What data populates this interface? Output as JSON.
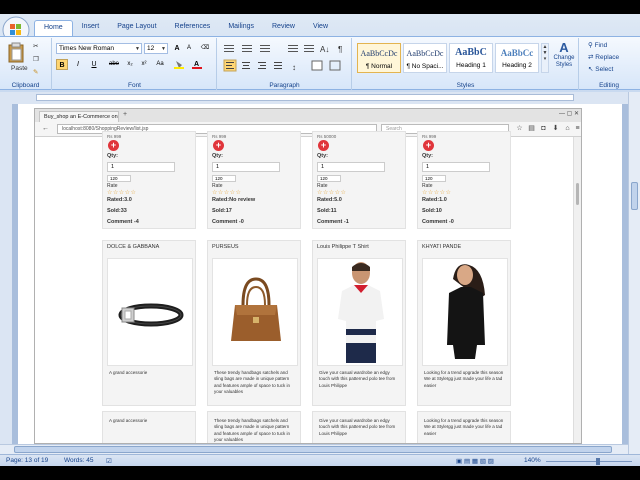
{
  "word": {
    "tabs": [
      "Home",
      "Insert",
      "Page Layout",
      "References",
      "Mailings",
      "Review",
      "View"
    ],
    "clipboard": {
      "paste_label": "Paste",
      "group_label": "Clipboard"
    },
    "font": {
      "family": "Times New Roman",
      "size": "12",
      "group_label": "Font",
      "bold": "B",
      "italic": "I",
      "underline": "U",
      "strike": "abe",
      "subscript": "x₂",
      "superscript": "x²",
      "change_case": "Aa",
      "grow": "A",
      "shrink": "A"
    },
    "paragraph": {
      "group_label": "Paragraph"
    },
    "styles": {
      "group_label": "Styles",
      "items": [
        {
          "preview": "AaBbCcDc",
          "name": "¶ Normal"
        },
        {
          "preview": "AaBbCcDc",
          "name": "¶ No Spaci..."
        },
        {
          "preview": "AaBbC",
          "name": "Heading 1"
        },
        {
          "preview": "AaBbCc",
          "name": "Heading 2"
        }
      ],
      "change_styles": "Change Styles"
    },
    "editing": {
      "group_label": "Editing",
      "find": "Find",
      "replace": "Replace",
      "select": "Select"
    },
    "status": {
      "page": "Page: 13 of 19",
      "words": "Words: 45",
      "zoom": "140%"
    }
  },
  "browser": {
    "tab_title": "Buy_shop an E-Commerce onli...",
    "url": "localhost:8080/ShoppingReview/list.jsp",
    "search_placeholder": "Search"
  },
  "top_products": [
    {
      "price": "Rs 999",
      "qty_label": "Qty:",
      "qty": "1",
      "select": "120",
      "rate_label": "Rate",
      "rated": "Rated:3.0",
      "sold": "Sold:33",
      "comments": "Comment -4"
    },
    {
      "price": "Rs 999",
      "qty_label": "Qty:",
      "qty": "1",
      "select": "120",
      "rate_label": "Rate",
      "rated": "Rated:No review",
      "sold": "Sold:17",
      "comments": "Comment -0"
    },
    {
      "price": "Rs 50000",
      "qty_label": "Qty:",
      "qty": "1",
      "select": "120",
      "rate_label": "Rate",
      "rated": "Rated:5.0",
      "sold": "Sold:11",
      "comments": "Comment -1"
    },
    {
      "price": "Rs 999",
      "qty_label": "Qty:",
      "qty": "1",
      "select": "120",
      "rate_label": "Rate",
      "rated": "Rated:1.0",
      "sold": "Sold:10",
      "comments": "Comment -0"
    }
  ],
  "bottom_products": [
    {
      "name": "DOLCE & GABBANA",
      "description": "A grand accessorie"
    },
    {
      "name": "PURSEUS",
      "description": "These trendy handbags satchels and sling bags are made in unique pattern and features ample of space to tuck in your valuables"
    },
    {
      "name": "Louis Philippe T Shirt",
      "description": "Give your casual wardrobe an edgy touch with this patterned polo tee from Louis Philippe"
    },
    {
      "name": "KHYATI PANDE",
      "description": "Looking for a trend upgrade this season We at StyleIgg just made your life a tad easier"
    }
  ],
  "third_row": [
    {
      "description": "A grand accessorie"
    },
    {
      "description": "These trendy handbags satchels and sling bags are made in unique pattern and features ample of space to tuck in your valuables"
    },
    {
      "description": "Give your casual wardrobe an edgy touch with this patterned polo tee from Louis Philippe"
    },
    {
      "description": "Looking for a trend upgrade this season We at StyleIgg just made your life a tad easier"
    }
  ],
  "colors": {
    "accent_red": "#e0353b",
    "star": "#e6a73a",
    "ribbon_text": "#15428b"
  }
}
